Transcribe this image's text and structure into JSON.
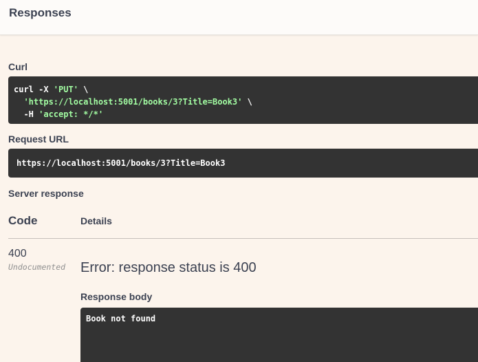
{
  "header": {
    "title": "Responses"
  },
  "curl": {
    "label": "Curl",
    "line1_cmd": "curl -X ",
    "line1_method": "'PUT'",
    "line1_tail": " \\",
    "line2_indent": "  ",
    "line2_url": "'https://localhost:5001/books/3?Title=Book3'",
    "line2_tail": " \\",
    "line3_cmd": "  -H ",
    "line3_header": "'accept: */*'"
  },
  "request_url": {
    "label": "Request URL",
    "value": "https://localhost:5001/books/3?Title=Book3"
  },
  "server_response": {
    "label": "Server response",
    "columns": {
      "code": "Code",
      "details": "Details"
    },
    "status_code": "400",
    "status_note": "Undocumented",
    "error_message": "Error: response status is 400",
    "body_label": "Response body",
    "body": "Book not found"
  },
  "colors": {
    "background": "#fcf4ec",
    "code_block_bg": "#333333",
    "string_green": "#a2fca2",
    "text": "#3b4151"
  }
}
